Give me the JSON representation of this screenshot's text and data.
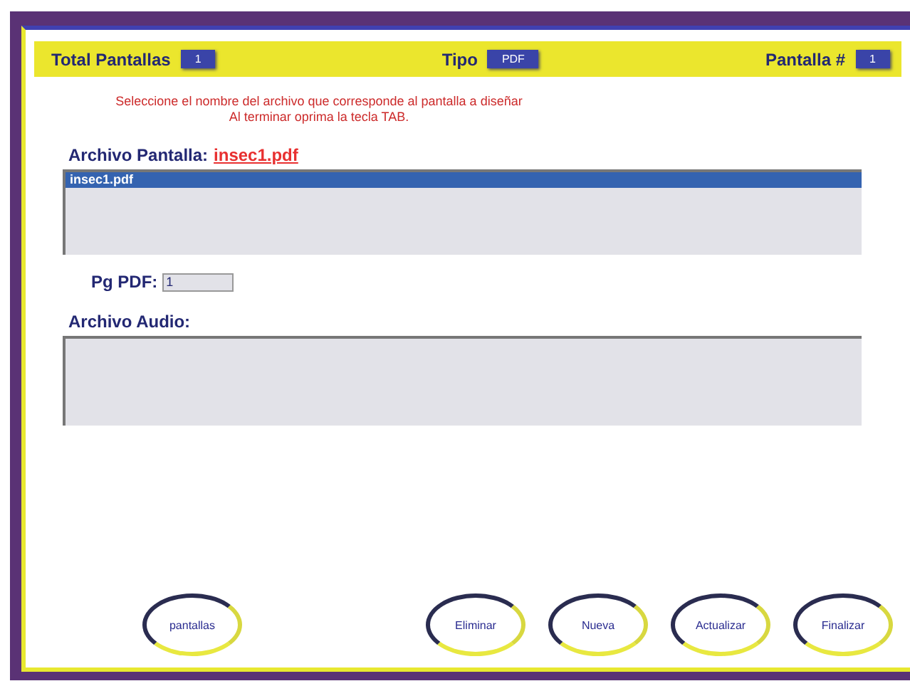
{
  "header": {
    "total_label": "Total Pantallas",
    "total_value": "1",
    "type_label": "Tipo",
    "type_value": "PDF",
    "screen_label": "Pantalla #",
    "screen_value": "1"
  },
  "instructions": [
    "Seleccione el nombre del archivo que corresponde al pantalla a diseñar",
    "Al terminar oprima la tecla TAB."
  ],
  "screen_file": {
    "label": "Archivo Pantalla:",
    "value": "insec1.pdf",
    "items": [
      {
        "label": "insec1.pdf",
        "selected": true
      }
    ]
  },
  "pg_pdf": {
    "label": "Pg PDF:",
    "value": "1"
  },
  "audio_file": {
    "label": "Archivo Audio:"
  },
  "buttons": {
    "left": [
      "pantallas"
    ],
    "right": [
      "Eliminar",
      "Nueva",
      "Actualizar",
      "Finalizar"
    ]
  }
}
